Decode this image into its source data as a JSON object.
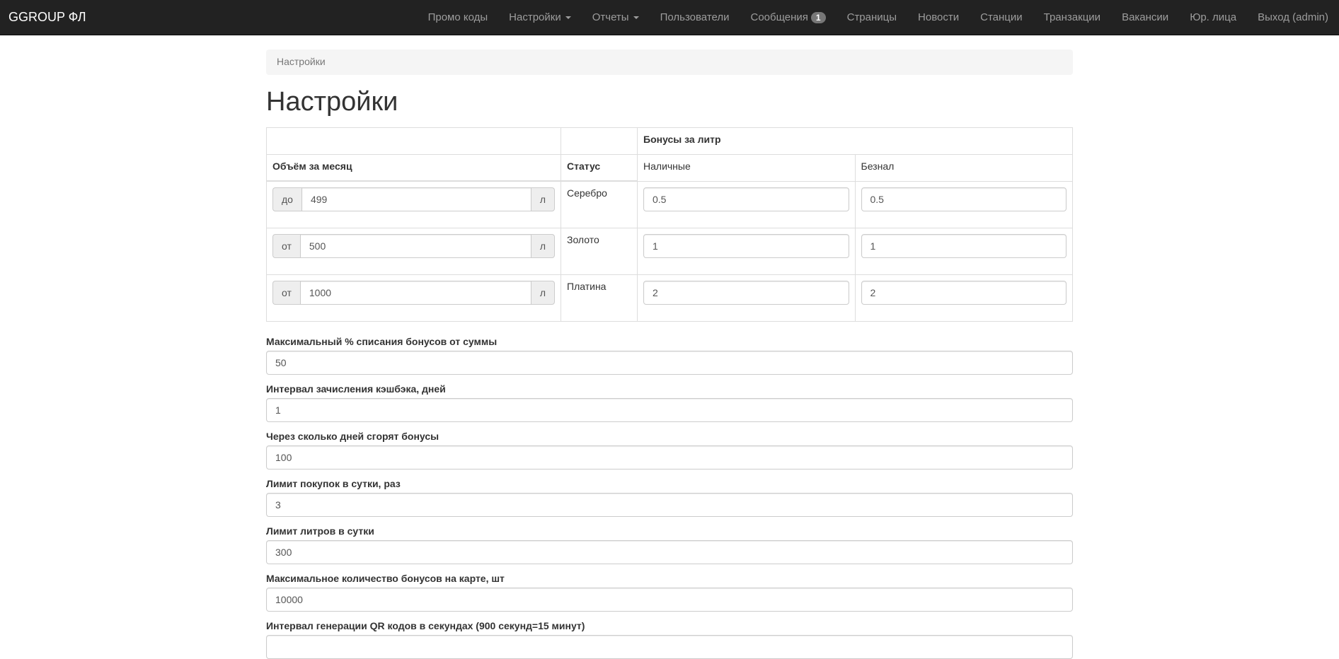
{
  "navbar": {
    "brand": "GGROUP ФЛ",
    "items": [
      {
        "label": "Промо коды"
      },
      {
        "label": "Настройки"
      },
      {
        "label": "Отчеты"
      },
      {
        "label": "Пользователи"
      },
      {
        "label": "Сообщения",
        "badge": "1"
      },
      {
        "label": "Страницы"
      },
      {
        "label": "Новости"
      },
      {
        "label": "Станции"
      },
      {
        "label": "Транзакции"
      },
      {
        "label": "Вакансии"
      },
      {
        "label": "Юр. лица"
      },
      {
        "label": "Выход (admin)"
      }
    ]
  },
  "breadcrumb": "Настройки",
  "page_title": "Настройки",
  "table": {
    "bonus_header": "Бонусы за литр",
    "col_volume": "Объём за месяц",
    "col_status": "Статус",
    "col_cash": "Наличные",
    "col_cashless": "Безнал",
    "unit": "л",
    "rows": [
      {
        "prefix": "до",
        "volume": "499",
        "status": "Серебро",
        "cash": "0.5",
        "cashless": "0.5"
      },
      {
        "prefix": "от",
        "volume": "500",
        "status": "Золото",
        "cash": "1",
        "cashless": "1"
      },
      {
        "prefix": "от",
        "volume": "1000",
        "status": "Платина",
        "cash": "2",
        "cashless": "2"
      }
    ]
  },
  "fields": [
    {
      "label": "Максимальный % списания бонусов от суммы",
      "value": "50"
    },
    {
      "label": "Интервал зачисления кэшбэка, дней",
      "value": "1"
    },
    {
      "label": "Через сколько дней сгорят бонусы",
      "value": "100"
    },
    {
      "label": "Лимит покупок в сутки, раз",
      "value": "3"
    },
    {
      "label": "Лимит литров в сутки",
      "value": "300"
    },
    {
      "label": "Максимальное количество бонусов на карте, шт",
      "value": "10000"
    },
    {
      "label": "Интервал генерации QR кодов в секундах (900 секунд=15 минут)",
      "value": ""
    }
  ]
}
